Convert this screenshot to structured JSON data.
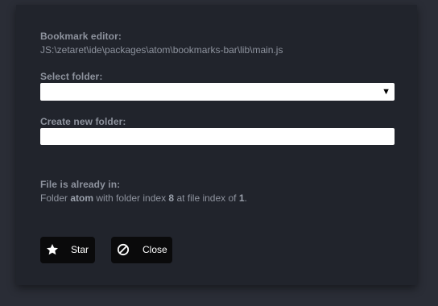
{
  "editor": {
    "title_label": "Bookmark editor:",
    "file_path": "JS:\\zetaret\\ide\\packages\\atom\\bookmarks-bar\\lib\\main.js"
  },
  "select_folder": {
    "label": "Select folder:",
    "selected_value": ""
  },
  "new_folder": {
    "label": "Create new folder:",
    "value": "",
    "placeholder": ""
  },
  "status": {
    "label": "File is already in:",
    "prefix": "Folder ",
    "folder_name": "atom",
    "middle": " with folder index ",
    "folder_index": "8",
    "suffix": " at file index of ",
    "file_index": "1",
    "end": "."
  },
  "buttons": {
    "star_label": "Star",
    "star_icon": "star-icon",
    "close_label": "Close",
    "close_icon": "ban-icon"
  }
}
